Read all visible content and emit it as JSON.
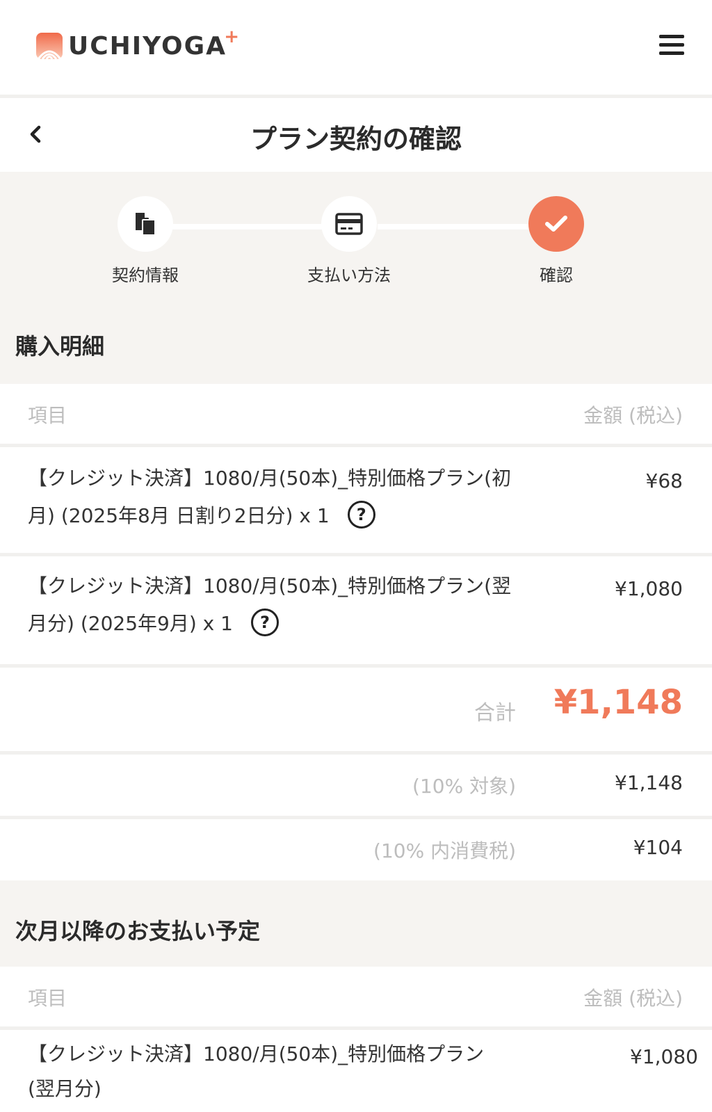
{
  "header": {
    "logo_text": "UCHIYOGA",
    "logo_plus": "+",
    "brand_color": "#f07a5a"
  },
  "titlebar": {
    "title": "プラン契約の確認"
  },
  "steps": [
    {
      "label": "契約情報",
      "icon": "documents-icon",
      "active": false
    },
    {
      "label": "支払い方法",
      "icon": "credit-card-icon",
      "active": false
    },
    {
      "label": "確認",
      "icon": "check-icon",
      "active": true
    }
  ],
  "purchase": {
    "section_title": "購入明細",
    "col_item": "項目",
    "col_amount": "金額 (税込)",
    "items": [
      {
        "line1": "【クレジット決済】1080/月(50本)_特別価格プラン(初",
        "line2": "月) (2025年8月 日割り2日分) x 1",
        "help": "?",
        "price": "¥68"
      },
      {
        "line1": "【クレジット決済】1080/月(50本)_特別価格プラン(翌",
        "line2": "月分) (2025年9月) x 1",
        "help": "?",
        "price": "¥1,080"
      }
    ],
    "total_label": "合計",
    "total_value": "¥1,148",
    "tax_target_label": "(10% 対象)",
    "tax_target_value": "¥1,148",
    "tax_included_label": "(10% 内消費税)",
    "tax_included_value": "¥104"
  },
  "schedule": {
    "section_title": "次月以降のお支払い予定",
    "col_item": "項目",
    "col_amount": "金額 (税込)",
    "items": [
      {
        "line1": "【クレジット決済】1080/月(50本)_特別価格プラン",
        "line2": "(翌月分)",
        "price": "¥1,080"
      }
    ]
  }
}
